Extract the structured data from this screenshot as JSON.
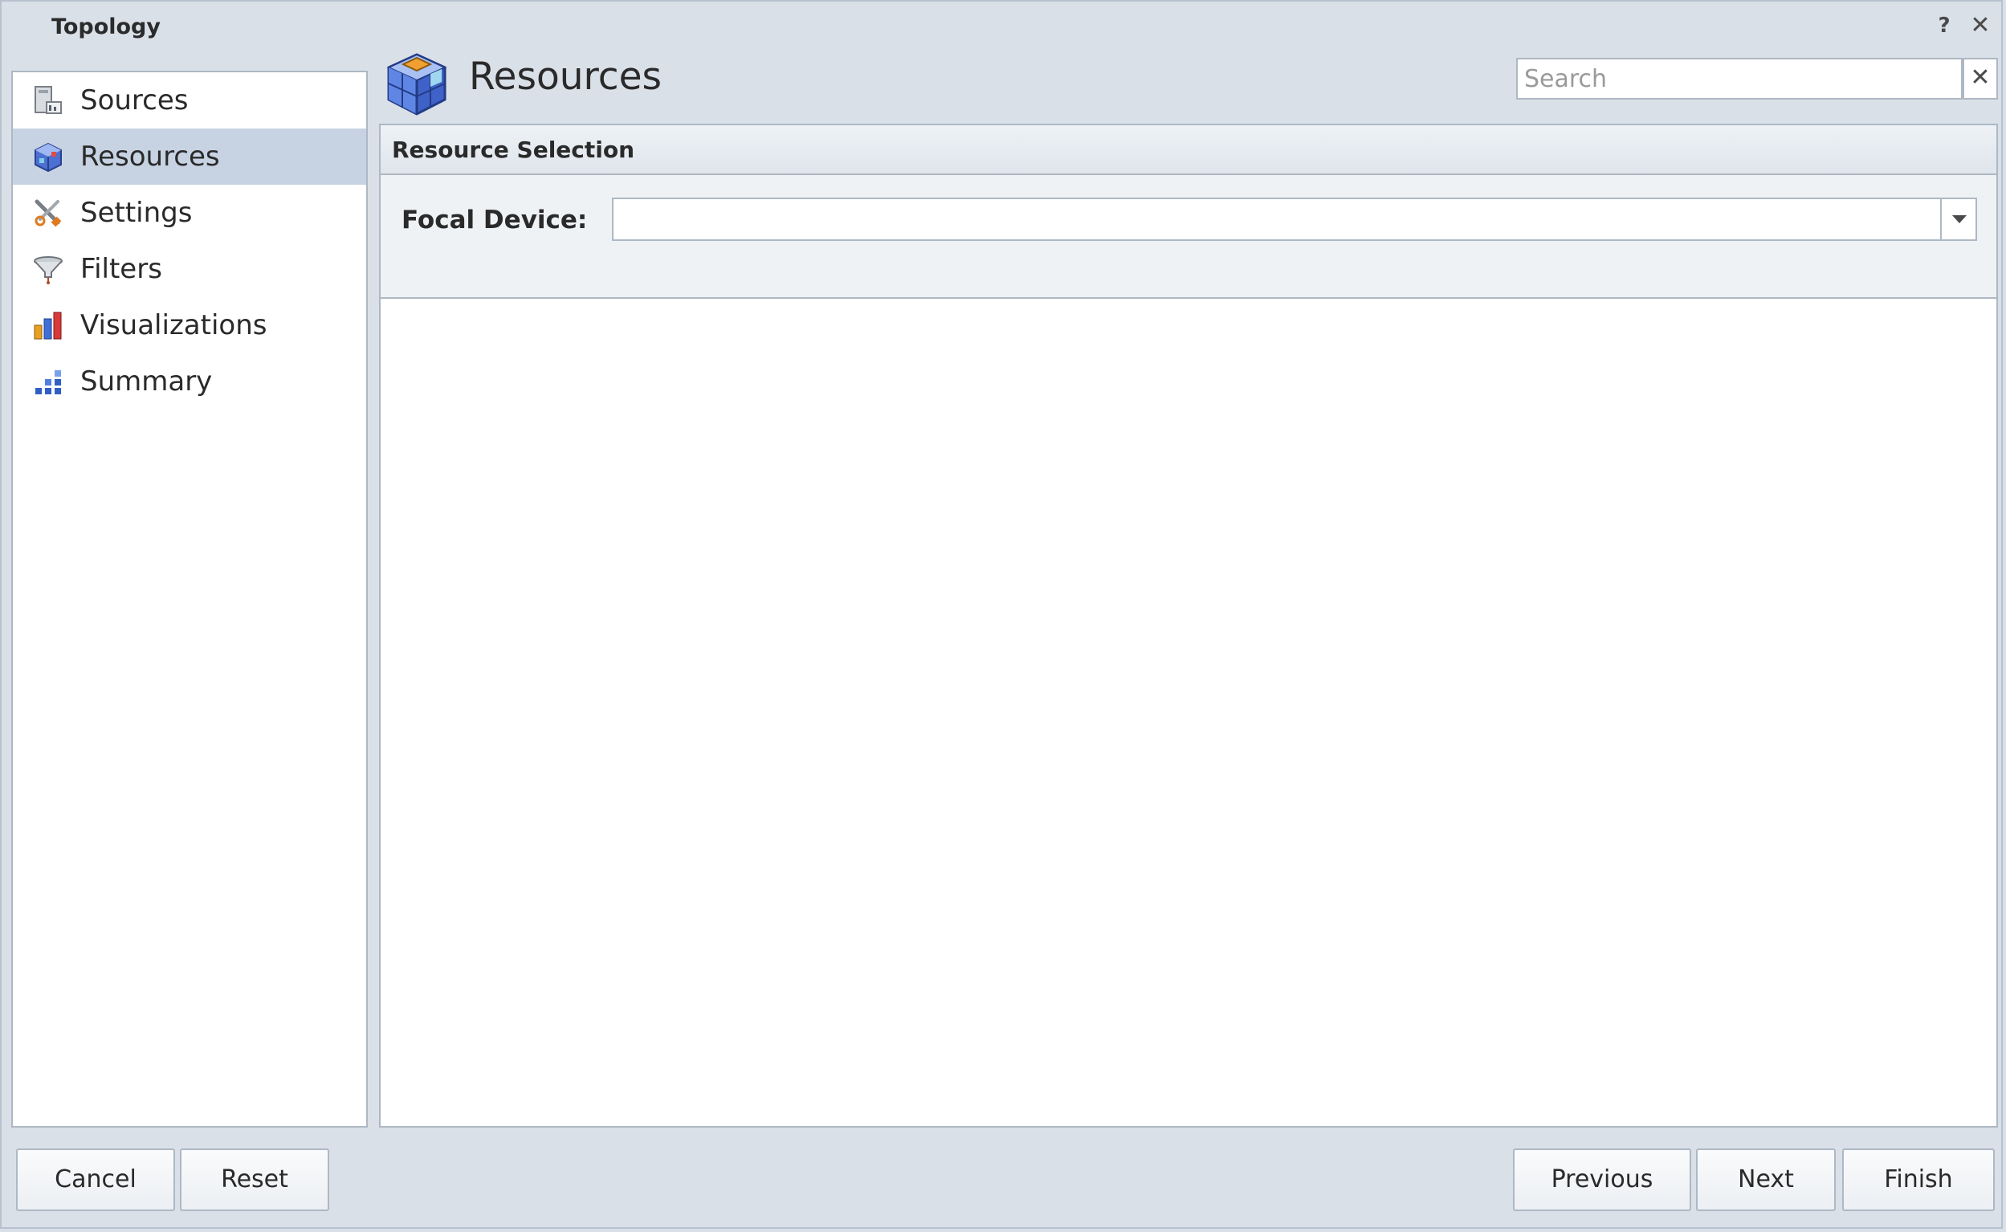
{
  "window": {
    "title": "Topology"
  },
  "titlebar": {
    "help_label": "?",
    "close_label": "✕"
  },
  "sidebar": {
    "items": [
      {
        "label": "Sources",
        "icon": "sources-icon"
      },
      {
        "label": "Resources",
        "icon": "resources-icon",
        "active": true
      },
      {
        "label": "Settings",
        "icon": "settings-icon"
      },
      {
        "label": "Filters",
        "icon": "filters-icon"
      },
      {
        "label": "Visualizations",
        "icon": "visualizations-icon"
      },
      {
        "label": "Summary",
        "icon": "summary-icon"
      }
    ]
  },
  "header": {
    "title": "Resources",
    "icon": "resources-cube-icon",
    "search": {
      "placeholder": "Search",
      "value": "",
      "clear_label": "✕"
    }
  },
  "main": {
    "section_title": "Resource Selection",
    "focal_device": {
      "label": "Focal Device:",
      "value": ""
    }
  },
  "footer": {
    "cancel_label": "Cancel",
    "reset_label": "Reset",
    "previous_label": "Previous",
    "next_label": "Next",
    "finish_label": "Finish"
  },
  "colors": {
    "window_bg": "#d9e0e8",
    "active_item_bg": "#c7d3e3",
    "border": "#aeb8c4"
  }
}
